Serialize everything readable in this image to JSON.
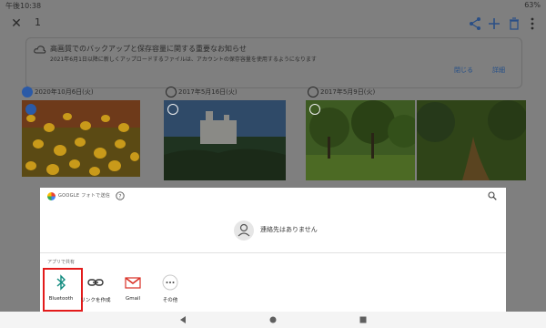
{
  "status_bar": {
    "time": "午後10:38",
    "battery": "63%"
  },
  "header": {
    "selected_count": "1"
  },
  "notice": {
    "title": "高画質でのバックアップと保存容量に関する重要なお知らせ",
    "body": "2021年6月1日以降に新しくアップロードするファイルは、アカウントの保存容量を使用するようになります",
    "close_label": "閉じる",
    "details_label": "詳細"
  },
  "photo_groups": [
    {
      "date": "2020年10月6日(火)",
      "selected": true
    },
    {
      "date": "2017年5月16日(火)",
      "selected": false
    },
    {
      "date": "2017年5月9日(火)",
      "selected": false
    }
  ],
  "share_sheet": {
    "title": "GOOGLE フォトで送信",
    "no_contacts": "連絡先はありません",
    "share_with_apps": "アプリで共有",
    "apps": [
      {
        "label": "Bluetooth",
        "icon": "bluetooth-icon"
      },
      {
        "label": "リンクを作成",
        "icon": "link-icon"
      },
      {
        "label": "Gmail",
        "icon": "gmail-icon"
      },
      {
        "label": "その他",
        "icon": "more-icon"
      }
    ]
  },
  "colors": {
    "highlight": "#e31b1b",
    "dim": "#7f7f7f",
    "accent": "#1a73e8"
  }
}
